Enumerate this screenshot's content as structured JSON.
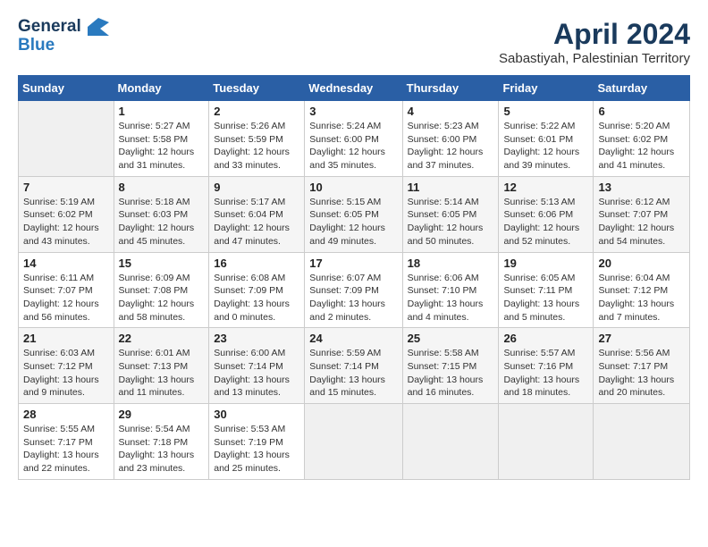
{
  "header": {
    "logo_general": "General",
    "logo_blue": "Blue",
    "title": "April 2024",
    "location": "Sabastiyah, Palestinian Territory"
  },
  "calendar": {
    "days": [
      "Sunday",
      "Monday",
      "Tuesday",
      "Wednesday",
      "Thursday",
      "Friday",
      "Saturday"
    ],
    "weeks": [
      [
        {
          "num": "",
          "info": ""
        },
        {
          "num": "1",
          "info": "Sunrise: 5:27 AM\nSunset: 5:58 PM\nDaylight: 12 hours\nand 31 minutes."
        },
        {
          "num": "2",
          "info": "Sunrise: 5:26 AM\nSunset: 5:59 PM\nDaylight: 12 hours\nand 33 minutes."
        },
        {
          "num": "3",
          "info": "Sunrise: 5:24 AM\nSunset: 6:00 PM\nDaylight: 12 hours\nand 35 minutes."
        },
        {
          "num": "4",
          "info": "Sunrise: 5:23 AM\nSunset: 6:00 PM\nDaylight: 12 hours\nand 37 minutes."
        },
        {
          "num": "5",
          "info": "Sunrise: 5:22 AM\nSunset: 6:01 PM\nDaylight: 12 hours\nand 39 minutes."
        },
        {
          "num": "6",
          "info": "Sunrise: 5:20 AM\nSunset: 6:02 PM\nDaylight: 12 hours\nand 41 minutes."
        }
      ],
      [
        {
          "num": "7",
          "info": "Sunrise: 5:19 AM\nSunset: 6:02 PM\nDaylight: 12 hours\nand 43 minutes."
        },
        {
          "num": "8",
          "info": "Sunrise: 5:18 AM\nSunset: 6:03 PM\nDaylight: 12 hours\nand 45 minutes."
        },
        {
          "num": "9",
          "info": "Sunrise: 5:17 AM\nSunset: 6:04 PM\nDaylight: 12 hours\nand 47 minutes."
        },
        {
          "num": "10",
          "info": "Sunrise: 5:15 AM\nSunset: 6:05 PM\nDaylight: 12 hours\nand 49 minutes."
        },
        {
          "num": "11",
          "info": "Sunrise: 5:14 AM\nSunset: 6:05 PM\nDaylight: 12 hours\nand 50 minutes."
        },
        {
          "num": "12",
          "info": "Sunrise: 5:13 AM\nSunset: 6:06 PM\nDaylight: 12 hours\nand 52 minutes."
        },
        {
          "num": "13",
          "info": "Sunrise: 6:12 AM\nSunset: 7:07 PM\nDaylight: 12 hours\nand 54 minutes."
        }
      ],
      [
        {
          "num": "14",
          "info": "Sunrise: 6:11 AM\nSunset: 7:07 PM\nDaylight: 12 hours\nand 56 minutes."
        },
        {
          "num": "15",
          "info": "Sunrise: 6:09 AM\nSunset: 7:08 PM\nDaylight: 12 hours\nand 58 minutes."
        },
        {
          "num": "16",
          "info": "Sunrise: 6:08 AM\nSunset: 7:09 PM\nDaylight: 13 hours\nand 0 minutes."
        },
        {
          "num": "17",
          "info": "Sunrise: 6:07 AM\nSunset: 7:09 PM\nDaylight: 13 hours\nand 2 minutes."
        },
        {
          "num": "18",
          "info": "Sunrise: 6:06 AM\nSunset: 7:10 PM\nDaylight: 13 hours\nand 4 minutes."
        },
        {
          "num": "19",
          "info": "Sunrise: 6:05 AM\nSunset: 7:11 PM\nDaylight: 13 hours\nand 5 minutes."
        },
        {
          "num": "20",
          "info": "Sunrise: 6:04 AM\nSunset: 7:12 PM\nDaylight: 13 hours\nand 7 minutes."
        }
      ],
      [
        {
          "num": "21",
          "info": "Sunrise: 6:03 AM\nSunset: 7:12 PM\nDaylight: 13 hours\nand 9 minutes."
        },
        {
          "num": "22",
          "info": "Sunrise: 6:01 AM\nSunset: 7:13 PM\nDaylight: 13 hours\nand 11 minutes."
        },
        {
          "num": "23",
          "info": "Sunrise: 6:00 AM\nSunset: 7:14 PM\nDaylight: 13 hours\nand 13 minutes."
        },
        {
          "num": "24",
          "info": "Sunrise: 5:59 AM\nSunset: 7:14 PM\nDaylight: 13 hours\nand 15 minutes."
        },
        {
          "num": "25",
          "info": "Sunrise: 5:58 AM\nSunset: 7:15 PM\nDaylight: 13 hours\nand 16 minutes."
        },
        {
          "num": "26",
          "info": "Sunrise: 5:57 AM\nSunset: 7:16 PM\nDaylight: 13 hours\nand 18 minutes."
        },
        {
          "num": "27",
          "info": "Sunrise: 5:56 AM\nSunset: 7:17 PM\nDaylight: 13 hours\nand 20 minutes."
        }
      ],
      [
        {
          "num": "28",
          "info": "Sunrise: 5:55 AM\nSunset: 7:17 PM\nDaylight: 13 hours\nand 22 minutes."
        },
        {
          "num": "29",
          "info": "Sunrise: 5:54 AM\nSunset: 7:18 PM\nDaylight: 13 hours\nand 23 minutes."
        },
        {
          "num": "30",
          "info": "Sunrise: 5:53 AM\nSunset: 7:19 PM\nDaylight: 13 hours\nand 25 minutes."
        },
        {
          "num": "",
          "info": ""
        },
        {
          "num": "",
          "info": ""
        },
        {
          "num": "",
          "info": ""
        },
        {
          "num": "",
          "info": ""
        }
      ]
    ]
  }
}
